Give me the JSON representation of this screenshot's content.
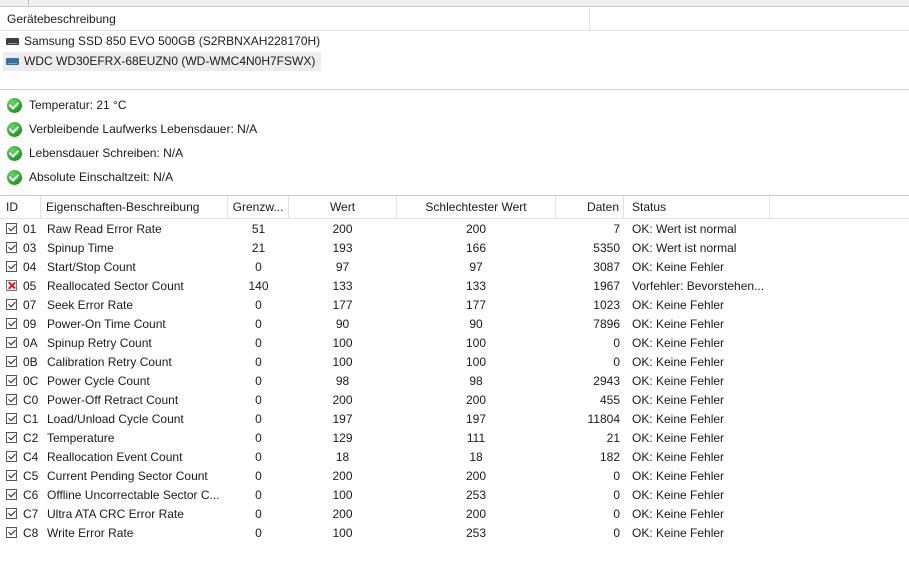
{
  "devices_header": "Gerätebeschreibung",
  "devices": [
    {
      "label": "Samsung SSD 850 EVO 500GB (S2RBNXAH228170H)",
      "icon": "drive-icon",
      "selected": false
    },
    {
      "label": "WDC WD30EFRX-68EUZN0 (WD-WMC4N0H7FSWX)",
      "icon": "drive-icon",
      "selected": true
    }
  ],
  "health": [
    {
      "label": "Temperatur: 21 °C",
      "icon": "ok-icon"
    },
    {
      "label": "Verbleibende Laufwerks Lebensdauer: N/A",
      "icon": "ok-icon"
    },
    {
      "label": "Lebensdauer Schreiben: N/A",
      "icon": "ok-icon"
    },
    {
      "label": "Absolute Einschaltzeit: N/A",
      "icon": "ok-icon"
    }
  ],
  "table": {
    "columns": [
      "ID",
      "Eigenschaften-Beschreibung",
      "Grenzw...",
      "Wert",
      "Schlechtester Wert",
      "Daten",
      "Status"
    ],
    "rows": [
      {
        "status_icon": "ok",
        "id": "01",
        "desc": "Raw Read Error Rate",
        "threshold": "51",
        "value": "200",
        "worst": "200",
        "raw": "7",
        "status": "OK: Wert ist normal"
      },
      {
        "status_icon": "ok",
        "id": "03",
        "desc": "Spinup Time",
        "threshold": "21",
        "value": "193",
        "worst": "166",
        "raw": "5350",
        "status": "OK: Wert ist normal"
      },
      {
        "status_icon": "ok",
        "id": "04",
        "desc": "Start/Stop Count",
        "threshold": "0",
        "value": "97",
        "worst": "97",
        "raw": "3087",
        "status": "OK: Keine Fehler"
      },
      {
        "status_icon": "bad",
        "id": "05",
        "desc": "Reallocated Sector Count",
        "threshold": "140",
        "value": "133",
        "worst": "133",
        "raw": "1967",
        "status": "Vorfehler: Bevorstehen..."
      },
      {
        "status_icon": "ok",
        "id": "07",
        "desc": "Seek Error Rate",
        "threshold": "0",
        "value": "177",
        "worst": "177",
        "raw": "1023",
        "status": "OK: Keine Fehler"
      },
      {
        "status_icon": "ok",
        "id": "09",
        "desc": "Power-On Time Count",
        "threshold": "0",
        "value": "90",
        "worst": "90",
        "raw": "7896",
        "status": "OK: Keine Fehler"
      },
      {
        "status_icon": "ok",
        "id": "0A",
        "desc": "Spinup Retry Count",
        "threshold": "0",
        "value": "100",
        "worst": "100",
        "raw": "0",
        "status": "OK: Keine Fehler"
      },
      {
        "status_icon": "ok",
        "id": "0B",
        "desc": "Calibration Retry Count",
        "threshold": "0",
        "value": "100",
        "worst": "100",
        "raw": "0",
        "status": "OK: Keine Fehler"
      },
      {
        "status_icon": "ok",
        "id": "0C",
        "desc": "Power Cycle Count",
        "threshold": "0",
        "value": "98",
        "worst": "98",
        "raw": "2943",
        "status": "OK: Keine Fehler"
      },
      {
        "status_icon": "ok",
        "id": "C0",
        "desc": "Power-Off Retract Count",
        "threshold": "0",
        "value": "200",
        "worst": "200",
        "raw": "455",
        "status": "OK: Keine Fehler"
      },
      {
        "status_icon": "ok",
        "id": "C1",
        "desc": "Load/Unload Cycle Count",
        "threshold": "0",
        "value": "197",
        "worst": "197",
        "raw": "11804",
        "status": "OK: Keine Fehler"
      },
      {
        "status_icon": "ok",
        "id": "C2",
        "desc": "Temperature",
        "threshold": "0",
        "value": "129",
        "worst": "111",
        "raw": "21",
        "status": "OK: Keine Fehler"
      },
      {
        "status_icon": "ok",
        "id": "C4",
        "desc": "Reallocation Event Count",
        "threshold": "0",
        "value": "18",
        "worst": "18",
        "raw": "182",
        "status": "OK: Keine Fehler"
      },
      {
        "status_icon": "ok",
        "id": "C5",
        "desc": "Current Pending Sector Count",
        "threshold": "0",
        "value": "200",
        "worst": "200",
        "raw": "0",
        "status": "OK: Keine Fehler"
      },
      {
        "status_icon": "ok",
        "id": "C6",
        "desc": "Offline Uncorrectable Sector C...",
        "threshold": "0",
        "value": "100",
        "worst": "253",
        "raw": "0",
        "status": "OK: Keine Fehler"
      },
      {
        "status_icon": "ok",
        "id": "C7",
        "desc": "Ultra ATA CRC Error Rate",
        "threshold": "0",
        "value": "200",
        "worst": "200",
        "raw": "0",
        "status": "OK: Keine Fehler"
      },
      {
        "status_icon": "ok",
        "id": "C8",
        "desc": "Write Error Rate",
        "threshold": "0",
        "value": "100",
        "worst": "253",
        "raw": "0",
        "status": "OK: Keine Fehler"
      }
    ]
  }
}
